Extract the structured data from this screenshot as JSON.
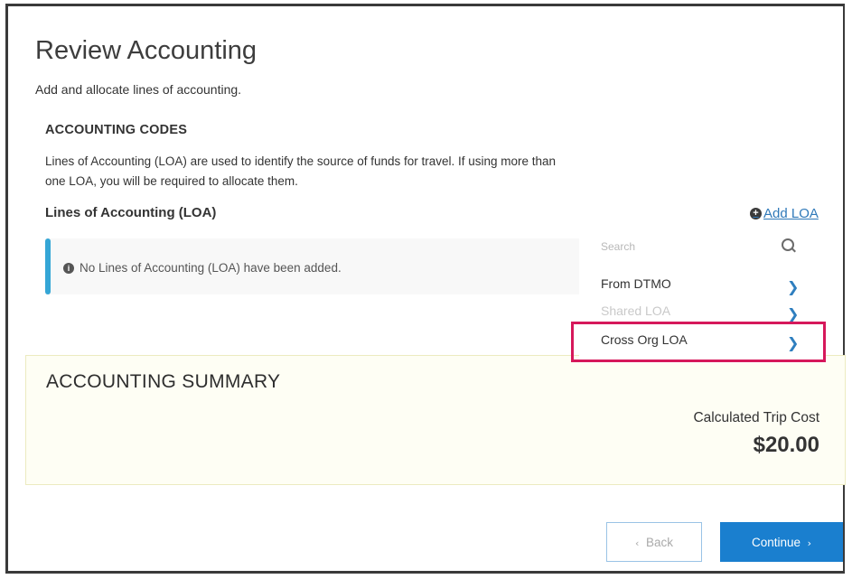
{
  "header": {
    "title": "Review Accounting",
    "subtitle": "Add and allocate lines of accounting."
  },
  "accounting_codes": {
    "heading": "ACCOUNTING CODES",
    "description": "Lines of Accounting (LOA) are used to identify the source of funds for travel. If using more than one LOA, you will be required to allocate them."
  },
  "loa_section": {
    "heading": "Lines of Accounting (LOA)",
    "add_label": "Add LOA",
    "empty_message": "No Lines of Accounting (LOA) have been added."
  },
  "dropdown": {
    "search_placeholder": "Search",
    "items": [
      {
        "label": "From DTMO",
        "icon": "chevron-right-icon"
      },
      {
        "label": "Shared LOA",
        "icon": "chevron-right-icon"
      },
      {
        "label": "Cross Org LOA",
        "icon": "chevron-right-icon"
      }
    ],
    "highlighted_item": "Cross Org LOA"
  },
  "summary": {
    "title": "ACCOUNTING SUMMARY",
    "trip_cost_label": "Calculated Trip Cost",
    "trip_cost_value": "$20.00"
  },
  "footer": {
    "back_label": "Back",
    "back_icon": "‹",
    "continue_label": "Continue",
    "continue_icon": "›"
  },
  "colors": {
    "accent": "#1a7fcf",
    "link": "#2f79b9",
    "info_bar": "#35a6d6",
    "highlight": "#d6185b",
    "summary_bg": "#fefef4"
  }
}
